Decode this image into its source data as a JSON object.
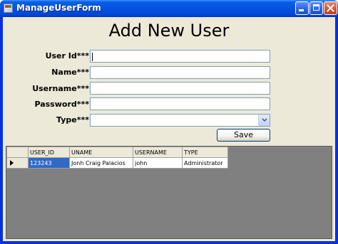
{
  "window": {
    "title": "ManageUserForm"
  },
  "form": {
    "heading": "Add New User",
    "fields": {
      "user_id": {
        "label": "User Id***",
        "value": ""
      },
      "name": {
        "label": "Name***",
        "value": ""
      },
      "username": {
        "label": "Username***",
        "value": ""
      },
      "password": {
        "label": "Password***",
        "value": ""
      },
      "type": {
        "label": "Type***",
        "value": ""
      }
    },
    "save_label": "Save"
  },
  "grid": {
    "columns": [
      "USER_ID",
      "UNAME",
      "USERNAME",
      "TYPE"
    ],
    "rows": [
      {
        "user_id": "123243",
        "uname": "Jonh Craig Palacios",
        "username": "john",
        "type": "Administrator"
      }
    ]
  },
  "icons": {
    "window_icon": "app-form-icon",
    "minimize": "minimize-icon",
    "maximize": "maximize-icon",
    "close": "close-icon",
    "dropdown": "chevron-down-icon",
    "row_indicator": "current-row-arrow-icon"
  },
  "colors": {
    "titlebar": "#0453df",
    "client_bg": "#ece9d8",
    "grid_bg": "#808080",
    "selection": "#316ac5"
  }
}
